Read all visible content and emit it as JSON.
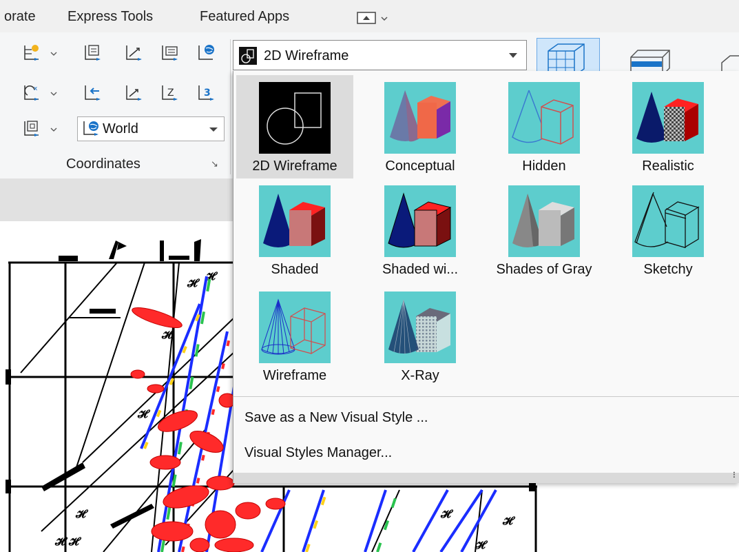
{
  "menubar": {
    "items": [
      {
        "label": "orate"
      },
      {
        "label": "Express Tools"
      },
      {
        "label": "Featured Apps"
      }
    ]
  },
  "coordinates_panel": {
    "ucs_value": "World",
    "title": "Coordinates",
    "launcher_glyph": "↘"
  },
  "visual_style_combo": {
    "value": "2D Wireframe"
  },
  "visual_styles": [
    {
      "label": "2D Wireframe",
      "selected": true
    },
    {
      "label": "Conceptual",
      "selected": false
    },
    {
      "label": "Hidden",
      "selected": false
    },
    {
      "label": "Realistic",
      "selected": false
    },
    {
      "label": "Shaded",
      "selected": false
    },
    {
      "label": "Shaded wi...",
      "selected": false
    },
    {
      "label": "Shades of Gray",
      "selected": false
    },
    {
      "label": "Sketchy",
      "selected": false
    },
    {
      "label": "Wireframe",
      "selected": false
    },
    {
      "label": "X-Ray",
      "selected": false
    }
  ],
  "commands": {
    "save_new": "Save as a New Visual Style ...",
    "manager": "Visual Styles Manager..."
  },
  "colors": {
    "thumb_bg": "#5dcdcd",
    "accent_blue": "#1a73c8",
    "selected_bg": "#dcdcdc",
    "drawing_red": "#ff2a2a",
    "drawing_blue": "#1a2dff"
  }
}
